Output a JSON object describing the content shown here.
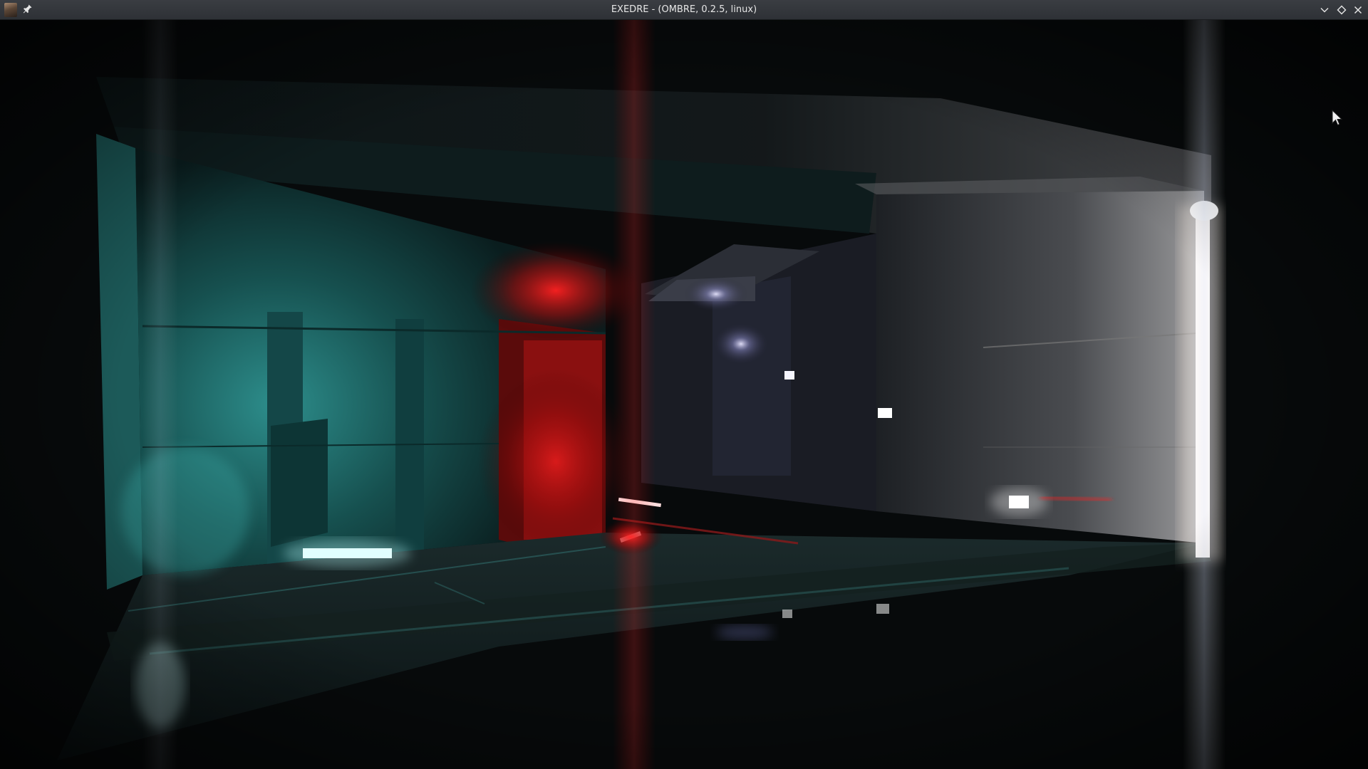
{
  "window": {
    "title": "EXEDRE - (OMBRE, 0.2.5, linux)",
    "icons": {
      "app": "app-portrait-icon",
      "pin": "pin-icon",
      "minimize": "chevron-down-icon",
      "maximize": "diamond-icon",
      "close": "close-icon"
    }
  },
  "scene": {
    "description_colors": {
      "teal_light": "#3fa7a2",
      "red_light": "#ff1a1a",
      "white_light": "#e9eef5",
      "violet_light": "#b8b8ff",
      "background": "#06090a"
    }
  }
}
